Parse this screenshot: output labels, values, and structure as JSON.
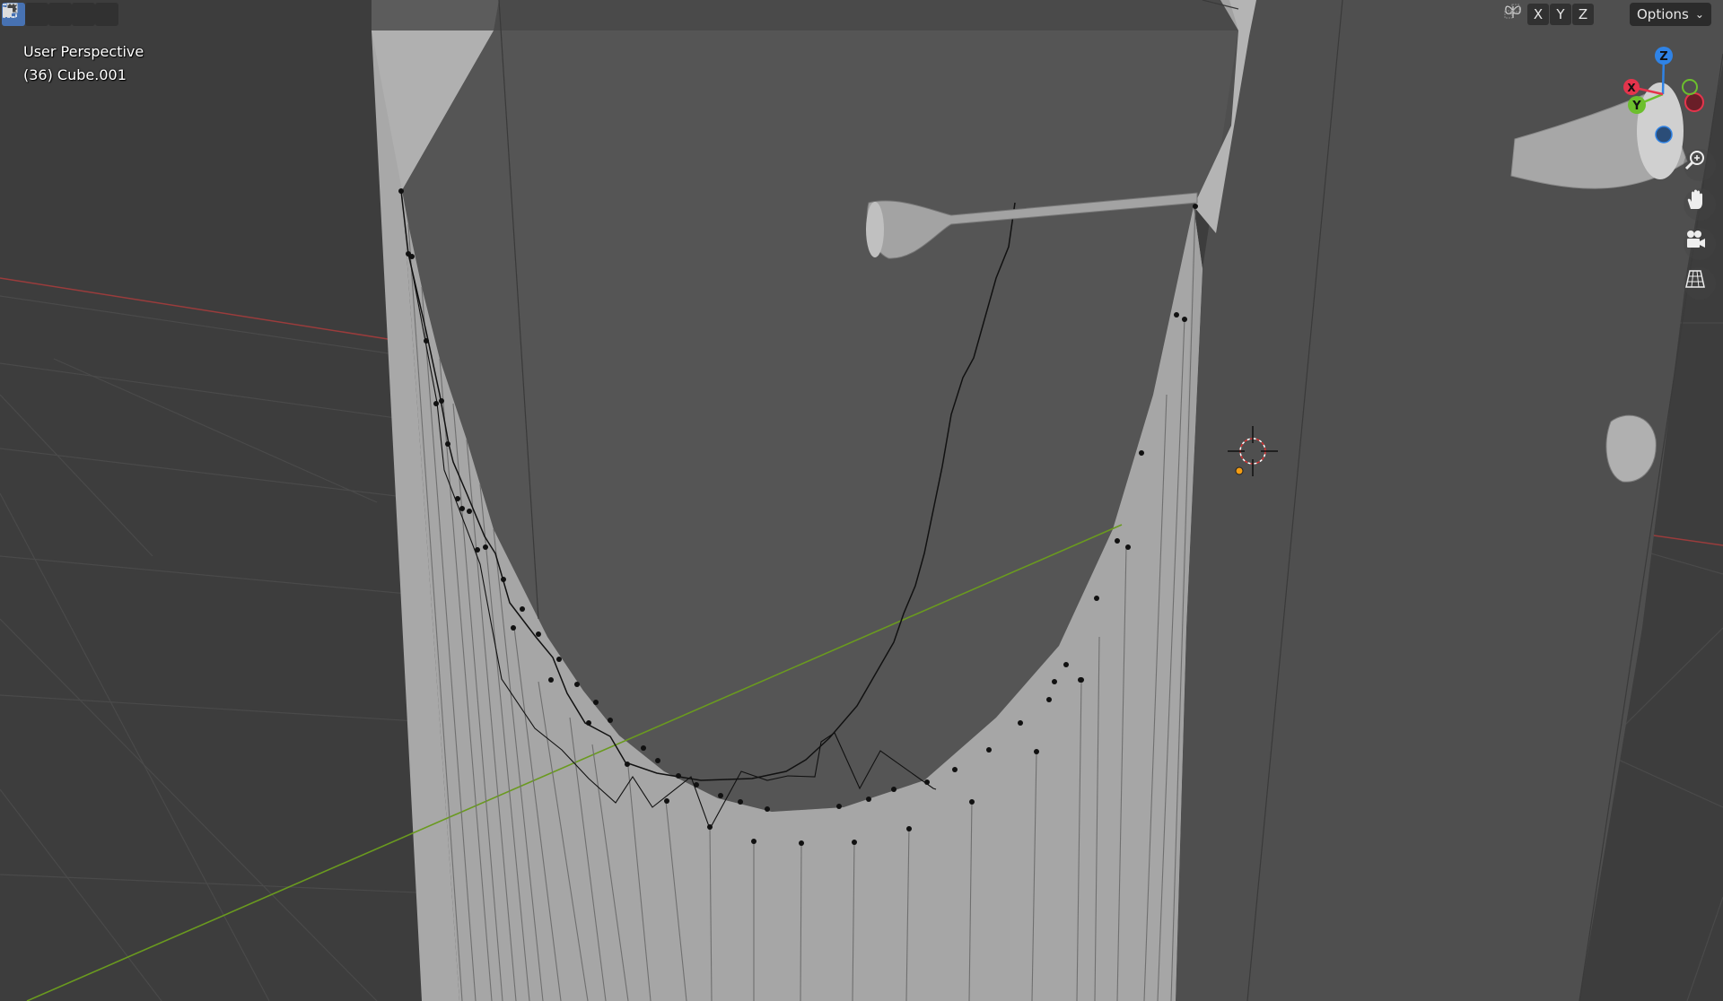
{
  "header": {
    "select_modes": [
      "select-new-icon",
      "select-extend-icon",
      "select-subtract-icon",
      "select-invert-icon",
      "select-intersect-icon"
    ],
    "mirror_icon": "butterfly-mirror-icon",
    "axes": [
      "X",
      "Y",
      "Z"
    ],
    "snap_icon": "auto-merge-icon",
    "options_label": "Options",
    "options_chevron": "chevron-down-icon"
  },
  "viewport": {
    "view_name": "User Perspective",
    "object_info": "(36) Cube.001",
    "background_color": "#3d3d3d",
    "mesh_color": "#a9a9a9",
    "grid_axis_x_color": "#9a3c3c",
    "grid_axis_y_color": "#6a9a1f"
  },
  "navigation_gizmo": {
    "axes": [
      {
        "label": "Z",
        "color": "#2f83e6"
      },
      {
        "label": "Y",
        "color": "#6cbf2d"
      },
      {
        "label": "X",
        "color": "#e5344c"
      }
    ]
  },
  "nav_buttons": [
    {
      "name": "zoom-icon"
    },
    {
      "name": "pan-hand-icon"
    },
    {
      "name": "camera-icon"
    },
    {
      "name": "ortho-grid-icon"
    }
  ]
}
